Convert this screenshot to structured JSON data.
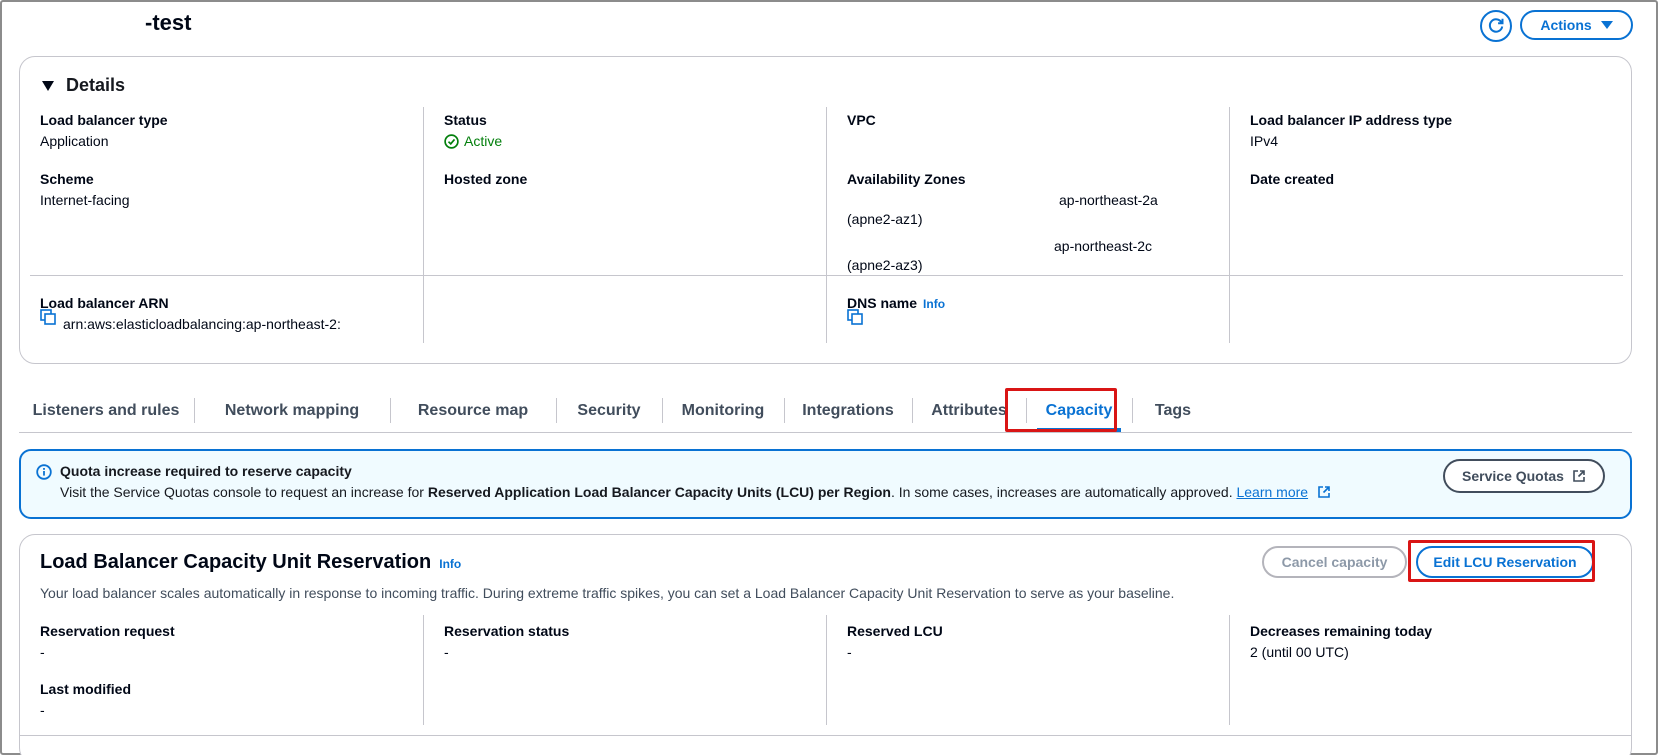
{
  "page": {
    "title": "-test"
  },
  "header": {
    "actions_label": "Actions"
  },
  "details": {
    "heading": "Details",
    "load_balancer_type": {
      "label": "Load balancer type",
      "value": "Application"
    },
    "status": {
      "label": "Status",
      "value": "Active"
    },
    "vpc": {
      "label": "VPC"
    },
    "ip_address_type": {
      "label": "Load balancer IP address type",
      "value": "IPv4"
    },
    "scheme": {
      "label": "Scheme",
      "value": "Internet-facing"
    },
    "hosted_zone": {
      "label": "Hosted zone"
    },
    "availability_zones": {
      "label": "Availability Zones",
      "zones": [
        {
          "name": "ap-northeast-2a",
          "id": "(apne2-az1)"
        },
        {
          "name": "ap-northeast-2c",
          "id": "(apne2-az3)"
        }
      ]
    },
    "date_created": {
      "label": "Date created"
    },
    "arn": {
      "label": "Load balancer ARN",
      "value": "arn:aws:elasticloadbalancing:ap-northeast-2:"
    },
    "dns_name": {
      "label": "DNS name",
      "info": "Info"
    }
  },
  "tabs": [
    {
      "label": "Listeners and rules"
    },
    {
      "label": "Network mapping"
    },
    {
      "label": "Resource map"
    },
    {
      "label": "Security"
    },
    {
      "label": "Monitoring"
    },
    {
      "label": "Integrations"
    },
    {
      "label": "Attributes"
    },
    {
      "label": "Capacity"
    },
    {
      "label": "Tags"
    }
  ],
  "active_tab": "Capacity",
  "alert": {
    "title": "Quota increase required to reserve capacity",
    "body_prefix": "Visit the Service Quotas console to request an increase for ",
    "body_bold": "Reserved Application Load Balancer Capacity Units (LCU) per Region",
    "body_suffix": ". In some cases, increases are automatically approved. ",
    "learn_more": "Learn more",
    "button_label": "Service Quotas"
  },
  "lcu": {
    "title": "Load Balancer Capacity Unit Reservation",
    "info": "Info",
    "description": "Your load balancer scales automatically in response to incoming traffic. During extreme traffic spikes, you can set a Load Balancer Capacity Unit Reservation to serve as your baseline.",
    "cancel_label": "Cancel capacity",
    "edit_label": "Edit LCU Reservation",
    "reservation_request": {
      "label": "Reservation request",
      "value": "-"
    },
    "reservation_status": {
      "label": "Reservation status",
      "value": "-"
    },
    "reserved_lcu": {
      "label": "Reserved LCU",
      "value": "-"
    },
    "decreases_remaining": {
      "label": "Decreases remaining today",
      "value": "2 (until 00 UTC)"
    },
    "last_modified": {
      "label": "Last modified",
      "value": "-"
    }
  },
  "colors": {
    "accent": "#0972d3",
    "success": "#037f0c",
    "highlight": "#d91515",
    "alert_bg": "#f0fbff"
  }
}
